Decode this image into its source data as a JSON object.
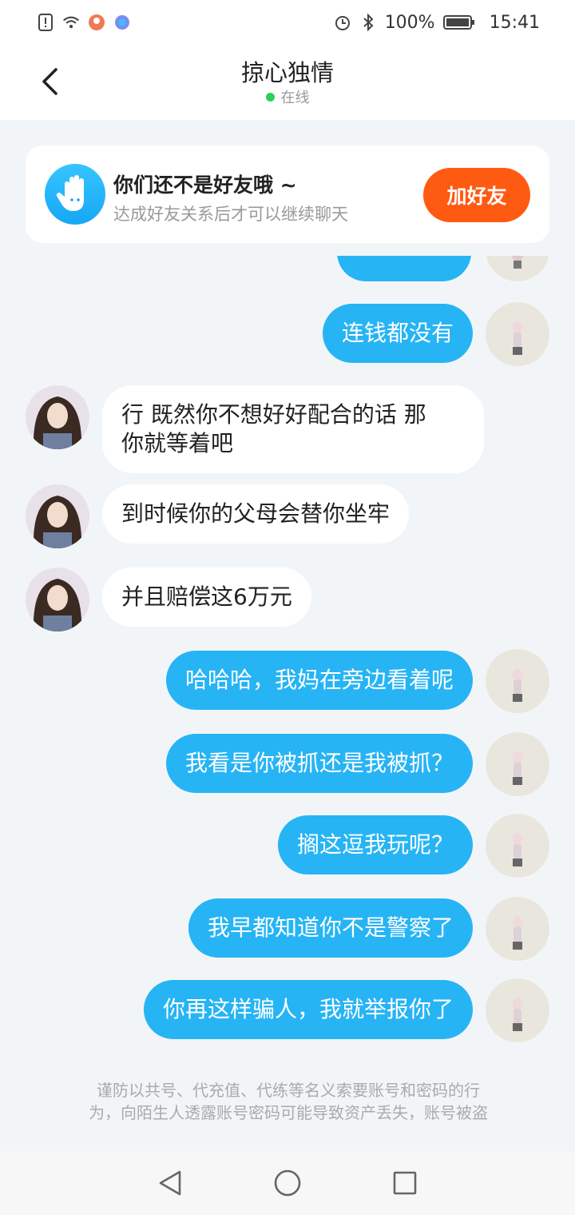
{
  "status_bar": {
    "battery": "100%",
    "time": "15:41"
  },
  "header": {
    "title": "掠心独情",
    "status": "在线"
  },
  "friend_card": {
    "title": "你们还不是好友哦 ~",
    "subtitle": "达成好友关系后才可以继续聊天",
    "button": "加好友"
  },
  "messages": [
    {
      "from": "me",
      "text": "连钱都没有"
    },
    {
      "from": "other",
      "line1": "行 既然你不想好好配合的话 那",
      "line2": "你就等着吧"
    },
    {
      "from": "other",
      "text": "到时候你的父母会替你坐牢"
    },
    {
      "from": "other",
      "text": "并且赔偿这6万元"
    },
    {
      "from": "me",
      "text": "哈哈哈，我妈在旁边看着呢"
    },
    {
      "from": "me",
      "text": "我看是你被抓还是我被抓？"
    },
    {
      "from": "me",
      "text": "搁这逗我玩呢？"
    },
    {
      "from": "me",
      "text": "我早都知道你不是警察了"
    },
    {
      "from": "me",
      "text": "你再这样骗人，我就举报你了"
    }
  ],
  "disclaimer": {
    "line1": "谨防以共号、代充值、代练等名义索要账号和密码的行",
    "line2": "为，向陌生人透露账号密码可能导致资产丢失，账号被盗"
  },
  "colors": {
    "accent": "#27b4f5",
    "add_friend": "#ff5a12",
    "online": "#2bcf5a"
  }
}
